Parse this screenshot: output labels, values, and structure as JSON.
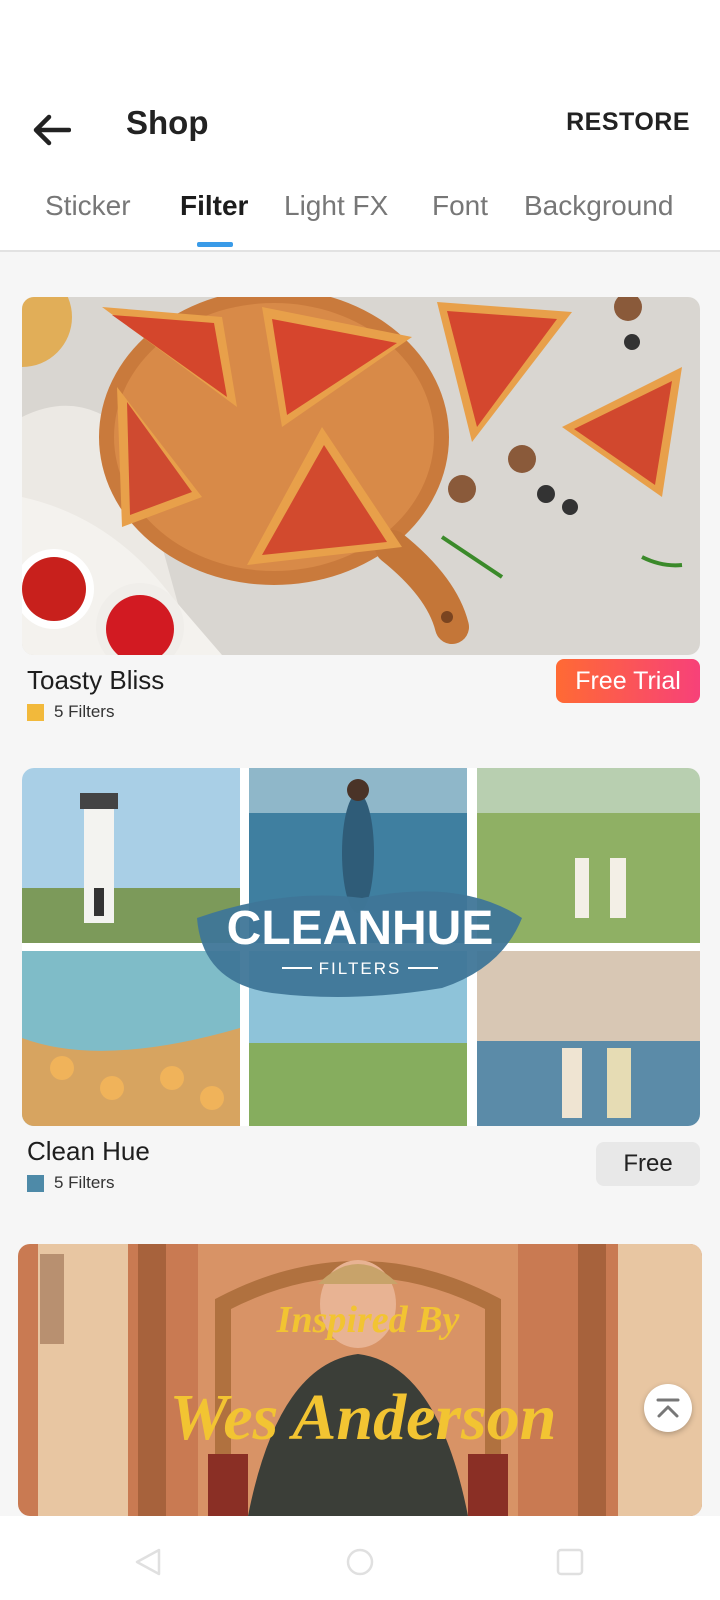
{
  "header": {
    "title": "Shop",
    "restore_label": "RESTORE"
  },
  "tabs": [
    {
      "label": "Sticker",
      "active": false
    },
    {
      "label": "Filter",
      "active": true
    },
    {
      "label": "Light FX",
      "active": false
    },
    {
      "label": "Font",
      "active": false
    },
    {
      "label": "Background",
      "active": false
    }
  ],
  "packs": [
    {
      "name": "Toasty Bliss",
      "count": "5 Filters",
      "swatch_color": "#f2b93b",
      "action_label": "Free Trial"
    },
    {
      "name": "Clean Hue",
      "count": "5 Filters",
      "swatch_color": "#4e8aa8",
      "action_label": "Free",
      "image_text": {
        "title": "CLEANHUE",
        "subtitle": "FILTERS"
      }
    },
    {
      "image_text": {
        "line1": "Inspired By",
        "line2": "Wes Anderson"
      }
    }
  ],
  "icons": {
    "back": "arrow-left-icon",
    "scroll_top": "chevron-up-double-icon",
    "nav_back": "triangle-back-icon",
    "nav_home": "circle-home-icon",
    "nav_recents": "square-recents-icon"
  }
}
